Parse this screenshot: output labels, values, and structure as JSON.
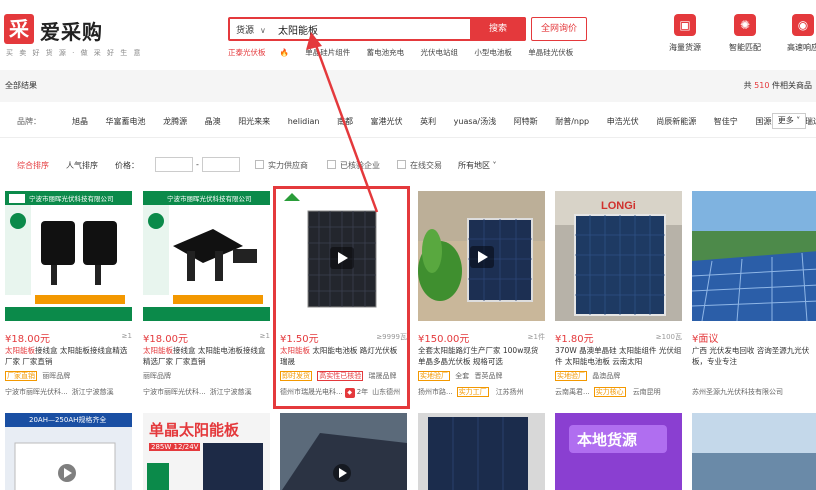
{
  "header": {
    "logo_mark": "采",
    "logo_name": "爱采购",
    "logo_slogan": "买 卖 好 货 源   ·   做 采 好 生 意",
    "search_type": "货源",
    "search_value": "太阳能板",
    "search_button": "搜索",
    "inquiry_button": "全网询价",
    "hot_links": [
      "正泰光伏板",
      "单晶硅片组件",
      "蓄电池充电",
      "光伏电站组",
      "小型电池板",
      "单晶硅光伏板"
    ],
    "icons": [
      {
        "label": "海量货源",
        "glyph": "▣"
      },
      {
        "label": "智能匹配",
        "glyph": "✺"
      },
      {
        "label": "高速响应",
        "glyph": "◉"
      }
    ]
  },
  "results": {
    "left": "全部结果",
    "right_prefix": "共 ",
    "count": "510",
    "right_suffix": " 件相关商品"
  },
  "brands": {
    "label": "品牌：",
    "items": [
      "旭晶",
      "华富蓄电池",
      "龙腾源",
      "晶澳",
      "阳光来来",
      "helidian",
      "南都",
      "富港光伏",
      "英利",
      "yuasa/汤浅",
      "阿特斯",
      "耐普/npp",
      "申浩光伏",
      "尚辰新能源",
      "智佳宁",
      "国源光伏",
      "瑞达"
    ],
    "more": "更多"
  },
  "filters": {
    "sort_default": "综合排序",
    "sort_popular": "人气排序",
    "price": "价格：",
    "dash": "-",
    "chk1": "实力供应商",
    "chk2": "已核验企业",
    "chk3": "在线交易",
    "region": "所有地区"
  },
  "products": [
    {
      "price": "¥18.00元",
      "sales": "≥1",
      "title_hl": "太阳能板",
      "title": "接线盒 太阳能板接线盒精选厂家 厂家直销",
      "tags": [
        "厂家直销",
        "丽晖品牌"
      ],
      "supplier": "宁波市丽晖光伏科...",
      "loc": "浙江宁波慈溪",
      "banner": "宁波市丽晖光伏科技有限公司"
    },
    {
      "price": "¥18.00元",
      "sales": "≥1",
      "title_hl": "太阳能板",
      "title": "接线盒 太阳能电池板接线盒精选厂家 厂家直销",
      "tags": [
        "丽晖品牌"
      ],
      "supplier": "宁波市丽晖光伏科...",
      "loc": "浙江宁波慈溪",
      "banner": "宁波市丽晖光伏科技有限公司"
    },
    {
      "price": "¥1.50元",
      "sales": "≥9999瓦",
      "title_hl": "太阳能板",
      "title": " 太阳能电池板 路灯光伏板 瑞晟",
      "tags": [
        "即时发货",
        "高实性已核验",
        "瑞晟品牌"
      ],
      "supplier": "德州市瑞晟光电科...",
      "loc": "山东德州",
      "years": "2年"
    },
    {
      "price": "¥150.00元",
      "sales": "≥1件",
      "title_hl": "",
      "title": "全套太阳能路灯生产厂家 100w现货单晶多晶光伏板 规格可选",
      "tags": [
        "实地验厂",
        "全套",
        "晋英品牌"
      ],
      "supplier": "扬州市路...",
      "loc": "江苏扬州",
      "factory": "实力工厂"
    },
    {
      "price": "¥1.80元",
      "sales": "≥100瓦",
      "title_hl": "",
      "title": "370W 晶澳单晶硅 太阳能组件 光伏组件 太阳能电池板 云南太阳",
      "tags": [
        "实地验厂",
        "晶澳品牌"
      ],
      "supplier": "云南禹君...",
      "loc": "云南昆明",
      "factory": "实力核心"
    },
    {
      "price": "¥面议",
      "sales": "",
      "title_hl": "",
      "title": "广西 光伏发电回收 咨询圣源九光伏板，专业专注",
      "tags": [],
      "supplier": "苏州圣源九光伏科技有限公司",
      "loc": ""
    }
  ],
  "row2": {
    "banner1": "20AH—250AH规格齐全",
    "banner2": "单晶太阳能板",
    "banner2_sub": "285W 12/24V",
    "banner5": "本地货源"
  }
}
